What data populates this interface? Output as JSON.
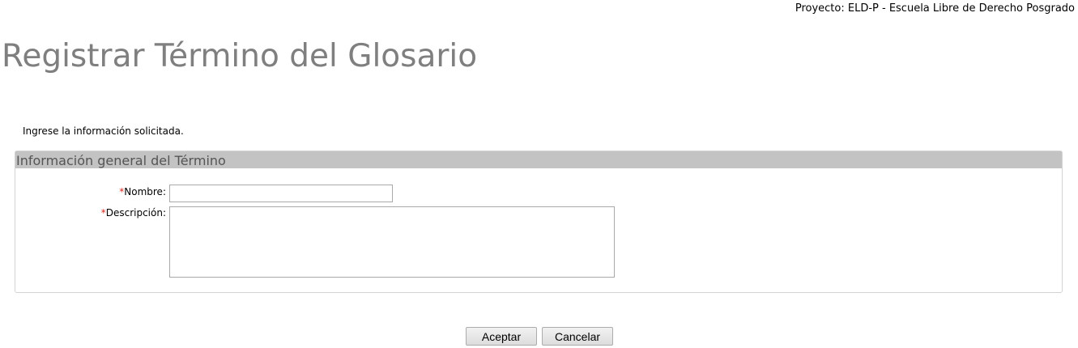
{
  "header": {
    "project_text": "Proyecto: ELD-P - Escuela Libre de Derecho Posgrado"
  },
  "page": {
    "title": "Registrar Término del Glosario",
    "instruction": "Ingrese la información solicitada."
  },
  "section": {
    "title": "Información general del Término",
    "fields": {
      "nombre": {
        "required_mark": "*",
        "label": "Nombre:",
        "value": ""
      },
      "descripcion": {
        "required_mark": "*",
        "label": "Descripción:",
        "value": ""
      }
    }
  },
  "actions": {
    "accept_label": "Aceptar",
    "cancel_label": "Cancelar"
  },
  "colors": {
    "title": "#7f7f7f",
    "section_header_bg": "#c3c3c3",
    "required": "#d9261c"
  }
}
